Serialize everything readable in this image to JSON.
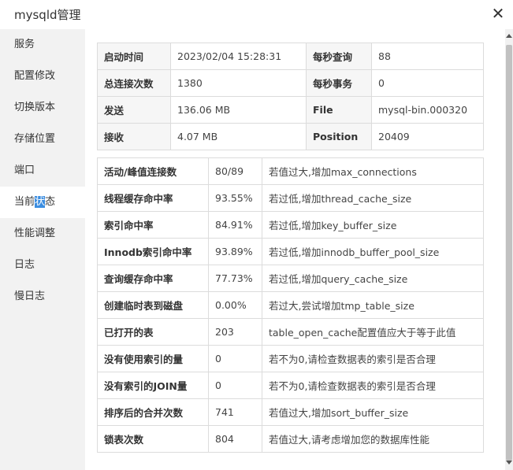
{
  "window": {
    "title": "mysqld管理"
  },
  "sidebar": {
    "items": [
      {
        "label": "服务"
      },
      {
        "label": "配置修改"
      },
      {
        "label": "切换版本"
      },
      {
        "label": "存储位置"
      },
      {
        "label": "端口"
      },
      {
        "label_pre": "当前",
        "label_hl": "状",
        "label_post": "态"
      },
      {
        "label": "性能调整"
      },
      {
        "label": "日志"
      },
      {
        "label": "慢日志"
      }
    ],
    "active_index": 5
  },
  "status_table": {
    "rows": [
      {
        "label1": "启动时间",
        "value1": "2023/02/04 15:28:31",
        "label2": "每秒查询",
        "value2": "88"
      },
      {
        "label1": "总连接次数",
        "value1": "1380",
        "label2": "每秒事务",
        "value2": "0"
      },
      {
        "label1": "发送",
        "value1": "136.06 MB",
        "label2": "File",
        "value2": "mysql-bin.000320"
      },
      {
        "label1": "接收",
        "value1": "4.07 MB",
        "label2": "Position",
        "value2": "20409"
      }
    ]
  },
  "perf_table": {
    "rows": [
      {
        "label": "活动/峰值连接数",
        "value": "80/89",
        "tip": "若值过大,增加max_connections"
      },
      {
        "label": "线程缓存命中率",
        "value": "93.55%",
        "tip": "若过低,增加thread_cache_size"
      },
      {
        "label": "索引命中率",
        "value": "84.91%",
        "tip": "若过低,增加key_buffer_size"
      },
      {
        "label": "Innodb索引命中率",
        "value": "93.89%",
        "tip": "若过低,增加innodb_buffer_pool_size"
      },
      {
        "label": "查询缓存命中率",
        "value": "77.73%",
        "tip": "若过低,增加query_cache_size"
      },
      {
        "label": "创建临时表到磁盘",
        "value": "0.00%",
        "tip": "若过大,尝试增加tmp_table_size"
      },
      {
        "label": "已打开的表",
        "value": "203",
        "tip": "table_open_cache配置值应大于等于此值"
      },
      {
        "label": "没有使用索引的量",
        "value": "0",
        "tip": "若不为0,请检查数据表的索引是否合理"
      },
      {
        "label": "没有索引的JOIN量",
        "value": "0",
        "tip": "若不为0,请检查数据表的索引是否合理"
      },
      {
        "label": "排序后的合并次数",
        "value": "741",
        "tip": "若值过大,增加sort_buffer_size"
      },
      {
        "label": "锁表次数",
        "value": "804",
        "tip": "若值过大,请考虑增加您的数据库性能"
      }
    ]
  },
  "icons": {
    "close": "close-icon",
    "scroll_up": "scroll-up-arrow-icon",
    "scroll_down": "scroll-down-arrow-icon"
  },
  "colors": {
    "active_highlight": "#3b8de0",
    "sidebar_bg": "#f2f2f2",
    "label_bg": "#f6f6f6",
    "border": "#dcdcdc"
  }
}
